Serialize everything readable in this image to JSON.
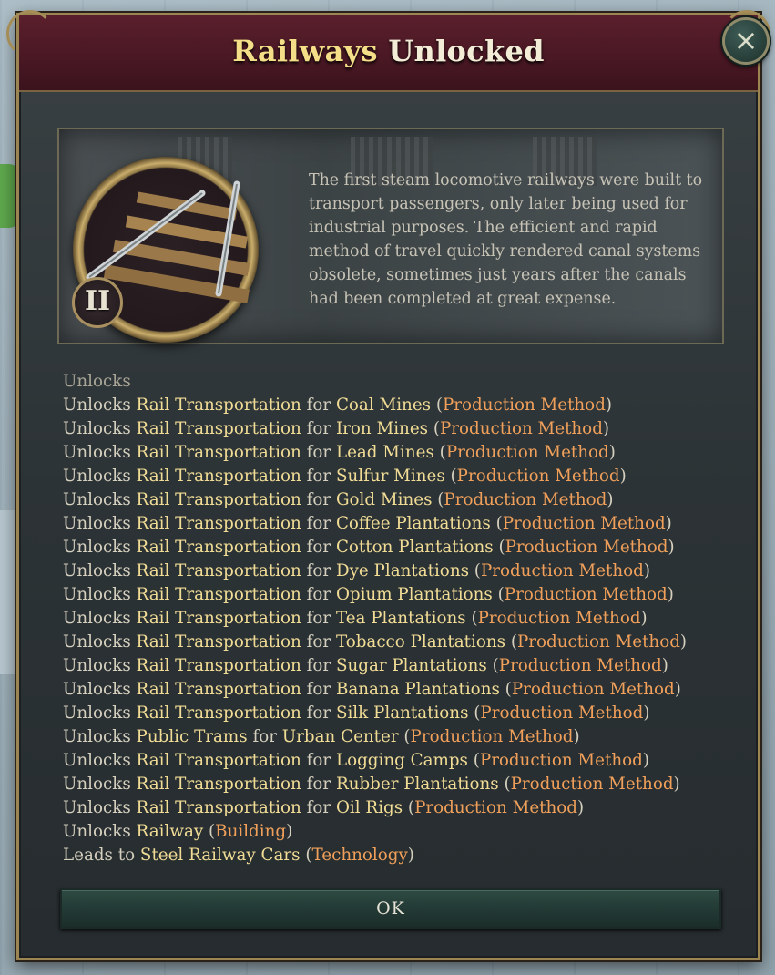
{
  "dialog": {
    "title_highlight": "Railways",
    "title_rest": " Unlocked",
    "close_label": "×",
    "tier": "II",
    "flavor_text": "The first steam locomotive railways were built to transport passengers, only later being used for industrial purposes. The efficient and rapid method of travel quickly rendered canal systems obsolete, sometimes just years after the canals had been completed at great expense.",
    "ok_label": "OK"
  },
  "unlocks": {
    "heading": "Unlocks",
    "lines": [
      {
        "prefix": "Unlocks",
        "a": "Rail Transportation",
        "mid": "for",
        "b": "Coal Mines",
        "type": "Production Method"
      },
      {
        "prefix": "Unlocks",
        "a": "Rail Transportation",
        "mid": "for",
        "b": "Iron Mines",
        "type": "Production Method"
      },
      {
        "prefix": "Unlocks",
        "a": "Rail Transportation",
        "mid": "for",
        "b": "Lead Mines",
        "type": "Production Method"
      },
      {
        "prefix": "Unlocks",
        "a": "Rail Transportation",
        "mid": "for",
        "b": "Sulfur Mines",
        "type": "Production Method"
      },
      {
        "prefix": "Unlocks",
        "a": "Rail Transportation",
        "mid": "for",
        "b": "Gold Mines",
        "type": "Production Method"
      },
      {
        "prefix": "Unlocks",
        "a": "Rail Transportation",
        "mid": "for",
        "b": "Coffee Plantations",
        "type": "Production Method"
      },
      {
        "prefix": "Unlocks",
        "a": "Rail Transportation",
        "mid": "for",
        "b": "Cotton Plantations",
        "type": "Production Method"
      },
      {
        "prefix": "Unlocks",
        "a": "Rail Transportation",
        "mid": "for",
        "b": "Dye Plantations",
        "type": "Production Method"
      },
      {
        "prefix": "Unlocks",
        "a": "Rail Transportation",
        "mid": "for",
        "b": "Opium Plantations",
        "type": "Production Method"
      },
      {
        "prefix": "Unlocks",
        "a": "Rail Transportation",
        "mid": "for",
        "b": "Tea Plantations",
        "type": "Production Method"
      },
      {
        "prefix": "Unlocks",
        "a": "Rail Transportation",
        "mid": "for",
        "b": "Tobacco Plantations",
        "type": "Production Method"
      },
      {
        "prefix": "Unlocks",
        "a": "Rail Transportation",
        "mid": "for",
        "b": "Sugar Plantations",
        "type": "Production Method"
      },
      {
        "prefix": "Unlocks",
        "a": "Rail Transportation",
        "mid": "for",
        "b": "Banana Plantations",
        "type": "Production Method"
      },
      {
        "prefix": "Unlocks",
        "a": "Rail Transportation",
        "mid": "for",
        "b": "Silk Plantations",
        "type": "Production Method"
      },
      {
        "prefix": "Unlocks",
        "a": "Public Trams",
        "mid": "for",
        "b": "Urban Center",
        "type": "Production Method"
      },
      {
        "prefix": "Unlocks",
        "a": "Rail Transportation",
        "mid": "for",
        "b": "Logging Camps",
        "type": "Production Method"
      },
      {
        "prefix": "Unlocks",
        "a": "Rail Transportation",
        "mid": "for",
        "b": "Rubber Plantations",
        "type": "Production Method"
      },
      {
        "prefix": "Unlocks",
        "a": "Rail Transportation",
        "mid": "for",
        "b": "Oil Rigs",
        "type": "Production Method"
      }
    ],
    "railway_line": {
      "prefix": "Unlocks",
      "a": "Railway",
      "type": "Building"
    },
    "leads_line": {
      "prefix": "Leads to",
      "a": "Steel Railway Cars",
      "type": "Technology"
    }
  },
  "colors": {
    "highlight": "#f1dc96",
    "link": "#f0a05a",
    "title_bar": "#4a1824",
    "ok_button": "#233a35"
  },
  "icons": {
    "close": "close-x-icon",
    "tech": "railway-tracks-icon"
  }
}
